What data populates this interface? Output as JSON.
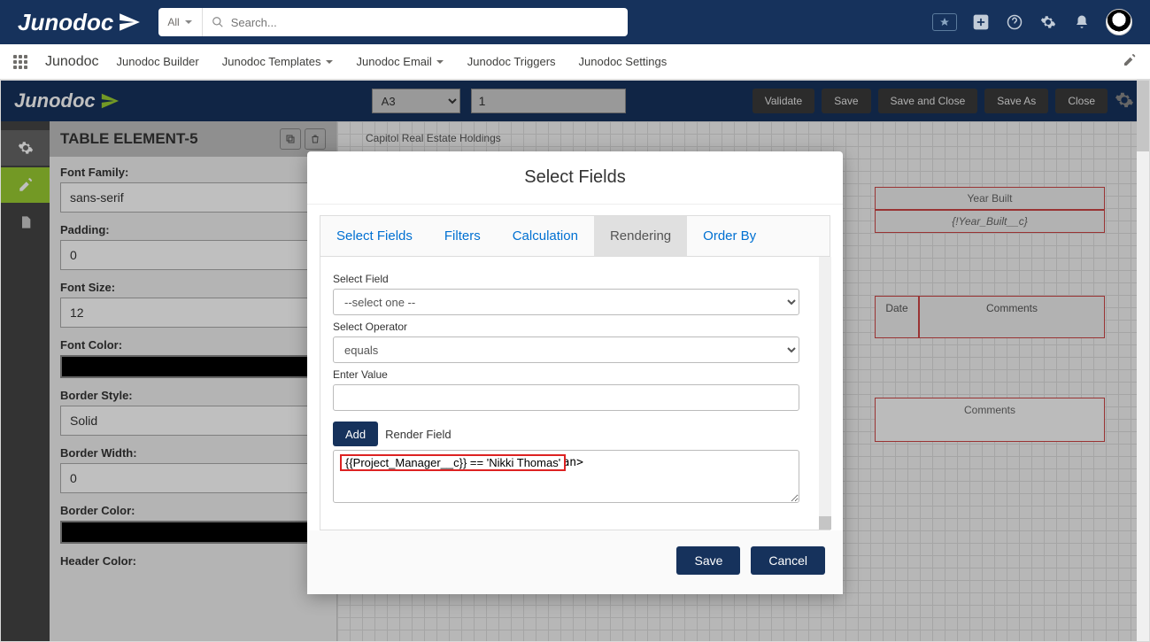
{
  "brand": "Junodoc",
  "search": {
    "all_label": "All",
    "placeholder": "Search..."
  },
  "nav": {
    "app_name": "Junodoc",
    "items": [
      {
        "label": "Junodoc Builder"
      },
      {
        "label": "Junodoc Templates"
      },
      {
        "label": "Junodoc Email"
      },
      {
        "label": "Junodoc Triggers"
      },
      {
        "label": "Junodoc Settings"
      }
    ]
  },
  "builder": {
    "logo": "Junodoc",
    "page_select": "A3",
    "page_num": "1",
    "buttons": {
      "validate": "Validate",
      "save": "Save",
      "save_close": "Save and Close",
      "save_as": "Save As",
      "close": "Close"
    }
  },
  "props": {
    "title": "TABLE ELEMENT-5",
    "font_family": {
      "label": "Font Family:",
      "value": "sans-serif"
    },
    "padding": {
      "label": "Padding:",
      "value": "0"
    },
    "font_size": {
      "label": "Font Size:",
      "value": "12"
    },
    "font_color": {
      "label": "Font Color:"
    },
    "border_style": {
      "label": "Border Style:",
      "value": "Solid"
    },
    "border_width": {
      "label": "Border Width:",
      "value": "0"
    },
    "border_color": {
      "label": "Border Color:"
    },
    "header_color": {
      "label": "Header Color:"
    }
  },
  "canvas": {
    "watermark": "Capitol Real Estate Holdings",
    "year_built_h": "Year Built",
    "year_built_f": "{!Year_Built__c}",
    "date_h": "Date",
    "comments_h": "Comments",
    "comments_b": "Comments"
  },
  "modal": {
    "title": "Select Fields",
    "tabs": {
      "select_fields": "Select Fields",
      "filters": "Filters",
      "calculation": "Calculation",
      "rendering": "Rendering",
      "order_by": "Order By"
    },
    "form": {
      "select_field_label": "Select Field",
      "select_field_value": "--select one --",
      "select_operator_label": "Select Operator",
      "select_operator_value": "equals",
      "enter_value_label": "Enter Value",
      "enter_value_value": "",
      "add_btn": "Add",
      "render_field_label": "Render Field",
      "textarea_value": "{{Project_Manager__c}} == 'Nikki Thomas'"
    },
    "footer": {
      "save": "Save",
      "cancel": "Cancel"
    }
  }
}
